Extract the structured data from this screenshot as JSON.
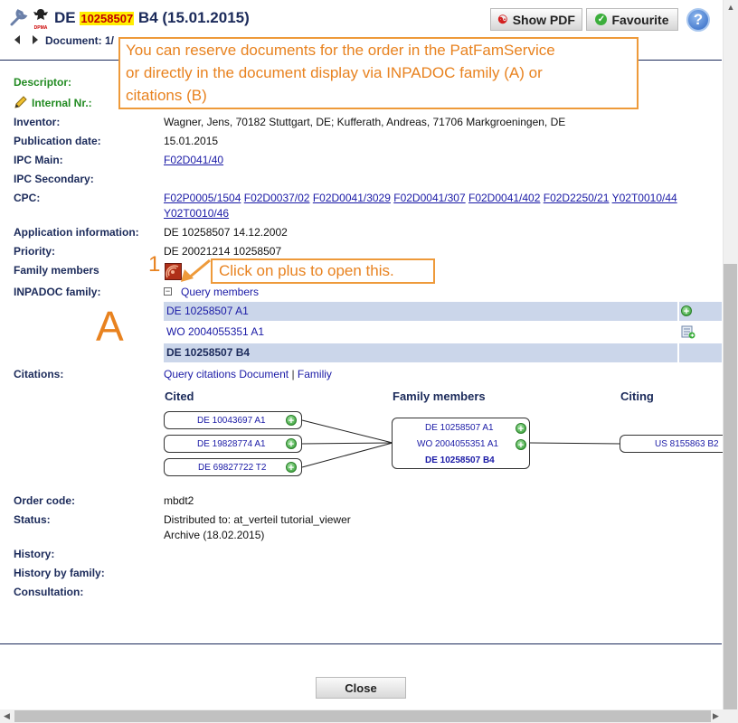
{
  "header": {
    "title_prefix": "DE ",
    "title_number": "10258507",
    "title_suffix": " B4 (15.01.2015)",
    "document_label": "Document: 1/",
    "eagle_label": "DPMA",
    "show_pdf_label": "Show PDF",
    "favourite_label": "Favourite",
    "help_label": "?"
  },
  "callouts": {
    "main": [
      "You can reserve documents for the order in the PatFamService",
      "or directly in the document display via INPADOC family (A) or",
      "citations (B)"
    ],
    "plus_hint": "Click on plus to open this.",
    "marker_1": "1",
    "marker_a": "A"
  },
  "fields": {
    "descriptor_label": "Descriptor:",
    "internal_label": "Internal Nr.:",
    "inventor_label": "Inventor:",
    "inventor_value": "Wagner, Jens, 70182 Stuttgart, DE; Kufferath, Andreas, 71706 Markgroeningen, DE",
    "pubdate_label": "Publication date:",
    "pubdate_value": "15.01.2015",
    "ipc_main_label": "IPC Main:",
    "ipc_main_value": "F02D041/40",
    "ipc_secondary_label": "IPC Secondary:",
    "cpc_label": "CPC:",
    "cpc_links": [
      "F02P0005/1504",
      "F02D0037/02",
      "F02D0041/3029",
      "F02D0041/307",
      "F02D0041/402",
      "F02D2250/21",
      "Y02T0010/44",
      "Y02T0010/46"
    ],
    "appinfo_label": "Application information:",
    "appinfo_value": "DE 10258507 14.12.2002",
    "priority_label": "Priority:",
    "priority_value": "DE 20021214 10258507",
    "family_label": "Family members",
    "inpadoc_label": "INPADOC family:",
    "query_members": "Query members",
    "citations_label": "Citations:",
    "query_citations": "Query citations",
    "citations_document": "Document",
    "citations_sep": "|",
    "citations_family": "Familiy",
    "order_label": "Order code:",
    "order_value": "mbdt2",
    "status_label": "Status:",
    "status_line1": "Distributed to: at_verteil tutorial_viewer",
    "status_line2": "Archive (18.02.2015)",
    "history_label": "History:",
    "history_family_label": "History by family:",
    "consultation_label": "Consultation:"
  },
  "inpadoc_rows": [
    {
      "doc": "DE 10258507 A1",
      "icon": "plus-icon"
    },
    {
      "doc": "WO 2004055351 A1",
      "icon": "reserve-document-icon"
    },
    {
      "doc": "DE 10258507 B4",
      "icon": ""
    }
  ],
  "graph": {
    "cited_header": "Cited",
    "family_header": "Family members",
    "citing_header": "Citing",
    "cited": [
      "DE 10043697 A1",
      "DE 19828774 A1",
      "DE 69827722 T2"
    ],
    "family": [
      "DE 10258507 A1",
      "WO 2004055351 A1",
      "DE 10258507 B4"
    ],
    "citing": [
      "US 8155863 B2"
    ]
  },
  "footer": {
    "close_label": "Close"
  },
  "colors": {
    "accent_orange": "#ee9a3a",
    "label_navy": "#1b2a5a",
    "link_blue": "#1a1aa6",
    "row_highlight": "#cbd6ea",
    "descriptor_green": "#228b22"
  }
}
